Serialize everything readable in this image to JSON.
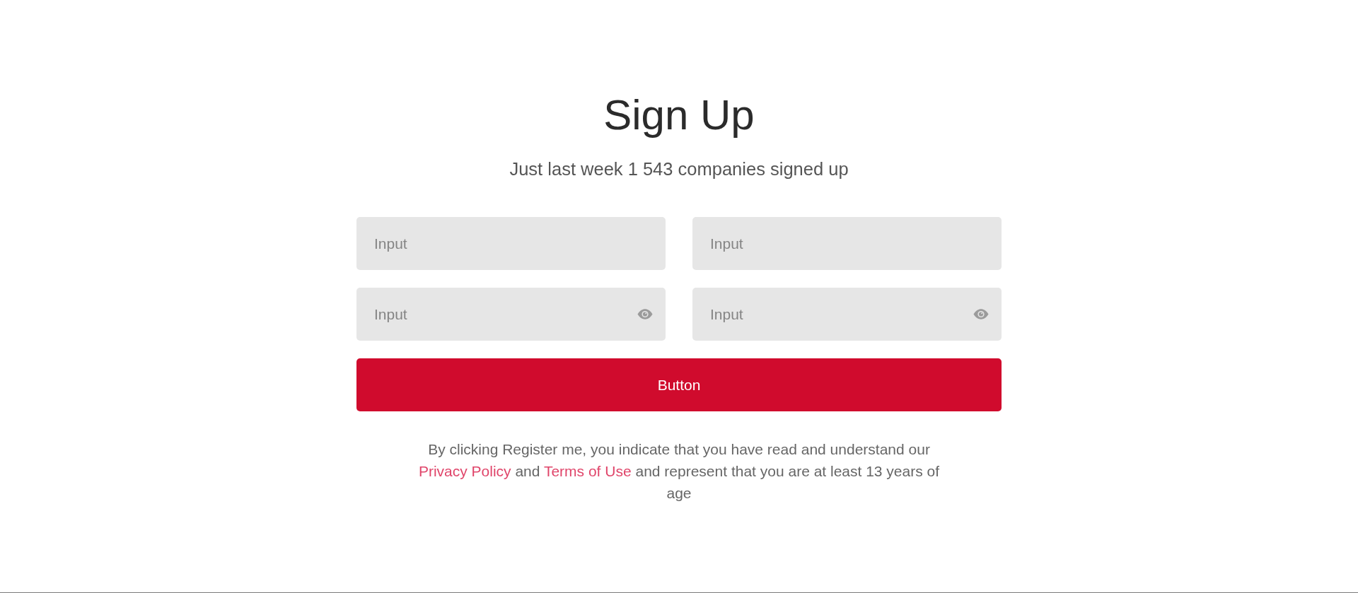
{
  "title": "Sign Up",
  "subtitle": "Just last week 1 543 companies signed up",
  "fields": [
    {
      "kind": "text",
      "placeholder": "Input"
    },
    {
      "kind": "text",
      "placeholder": "Input"
    },
    {
      "kind": "password",
      "placeholder": "Input"
    },
    {
      "kind": "password",
      "placeholder": "Input"
    }
  ],
  "submit_button": {
    "label": "Button"
  },
  "legal_notice": [
    {
      "kind": "text",
      "text": "By clicking Register me, you indicate that you have read and understand our "
    },
    {
      "kind": "link",
      "text": "Privacy Policy"
    },
    {
      "kind": "text",
      "text": " and "
    },
    {
      "kind": "link",
      "text": "Terms of Use"
    },
    {
      "kind": "text",
      "text": " and represent that you are at least 13 years of age"
    }
  ]
}
